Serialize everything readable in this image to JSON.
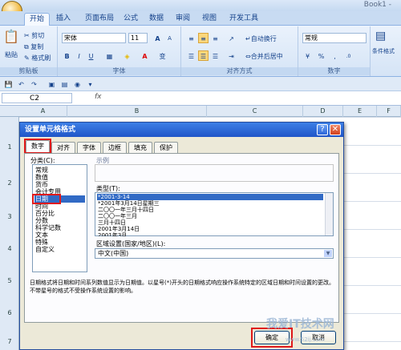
{
  "app": {
    "title": "Book1 -"
  },
  "ribbon_tabs": [
    "开始",
    "插入",
    "页面布局",
    "公式",
    "数据",
    "审阅",
    "视图",
    "开发工具"
  ],
  "ribbon": {
    "clipboard": {
      "paste": "粘贴",
      "cut": "剪切",
      "copy": "复制",
      "format_painter": "格式刷",
      "label": "剪贴板"
    },
    "font": {
      "name": "宋体",
      "size": "11",
      "grow": "A",
      "shrink": "A",
      "bold": "B",
      "italic": "I",
      "underline": "U",
      "label": "字体"
    },
    "alignment": {
      "wrap": "自动换行",
      "merge": "合并后居中",
      "label": "对齐方式"
    },
    "number": {
      "format": "常规",
      "label": "数字"
    },
    "styles": {
      "conditional": "条件格式"
    }
  },
  "formula_bar": {
    "cell": "C2",
    "fx": "fx",
    "value": ""
  },
  "columns": [
    "A",
    "B",
    "C",
    "D",
    "E",
    "F"
  ],
  "rows": [
    "1",
    "2",
    "3",
    "4",
    "5",
    "6",
    "7"
  ],
  "dialog": {
    "title": "设置单元格格式",
    "help": "?",
    "close": "✕",
    "tabs": [
      "数字",
      "对齐",
      "字体",
      "边框",
      "填充",
      "保护"
    ],
    "category_label": "分类(C):",
    "categories": [
      "常规",
      "数值",
      "货币",
      "会计专用",
      "日期",
      "时间",
      "百分比",
      "分数",
      "科学记数",
      "文本",
      "特殊",
      "自定义"
    ],
    "selected_category": "日期",
    "sample_label": "示例",
    "type_label": "类型(T):",
    "types": [
      "*2001-3-14",
      "*2001年3月14日星期三",
      "二〇〇一年三月十四日",
      "二〇〇一年三月",
      "三月十四日",
      "2001年3月14日",
      "2001年3月"
    ],
    "selected_type": "*2001-3-14",
    "locale_label": "区域设置(国家/地区)(L):",
    "locale_value": "中文(中国)",
    "description": "日期格式将日期和时间系列数值显示为日期值。以星号(*)开头的日期格式响应操作系统特定的区域日期和时间设置的更改。不带星号的格式不受操作系统设置的影响。",
    "ok": "确定",
    "cancel": "取消"
  },
  "watermark": {
    "text": "我爱IT技术网",
    "url": "www.52ij.com"
  },
  "colors": {
    "dialog_title": "#1f55c8",
    "selection": "#316ac5",
    "highlight_box": "#e01a1a",
    "ribbon_bg": "#d5e4f6"
  }
}
